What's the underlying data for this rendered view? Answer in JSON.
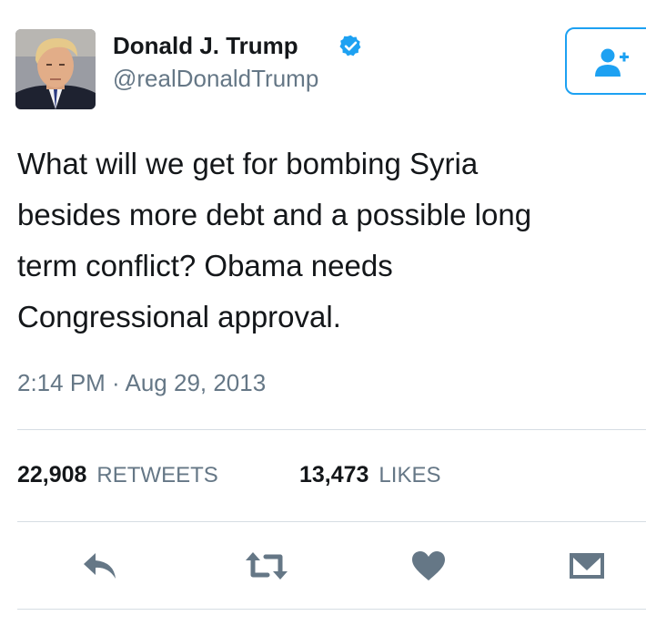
{
  "user": {
    "display_name": "Donald J. Trump",
    "handle": "@realDonaldTrump",
    "verified_icon": "verified-badge-icon",
    "avatar_icon": "profile-photo"
  },
  "follow_button": {
    "icon": "follow-user-plus-icon"
  },
  "tweet": {
    "text": "What will we get for bombing Syria\nbesides more debt and a possible long\nterm conflict? Obama needs\nCongressional approval.",
    "timestamp": "2:14 PM · Aug 29, 2013"
  },
  "stats": {
    "retweets_count": "22,908",
    "retweets_label": "RETWEETS",
    "likes_count": "13,473",
    "likes_label": "LIKES"
  },
  "actions": {
    "reply_icon": "reply-icon",
    "retweet_icon": "retweet-icon",
    "like_icon": "heart-icon",
    "dm_icon": "envelope-icon"
  },
  "colors": {
    "accent": "#1da1f2",
    "icon_gray": "#657786",
    "text": "#14171a",
    "divider": "#d6dde3"
  }
}
